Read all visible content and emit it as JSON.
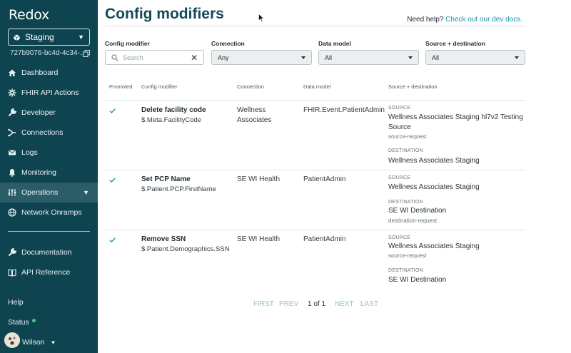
{
  "sidebar": {
    "logo": "Redox",
    "environment": "Staging",
    "environment_id": "727b9076-bc4d-4c34-...",
    "nav": [
      {
        "label": "Dashboard",
        "icon": "home-icon"
      },
      {
        "label": "FHIR API Actions",
        "icon": "fhir-icon"
      },
      {
        "label": "Developer",
        "icon": "wrench-icon"
      },
      {
        "label": "Connections",
        "icon": "connections-icon"
      },
      {
        "label": "Logs",
        "icon": "mail-icon"
      },
      {
        "label": "Monitoring",
        "icon": "bell-icon"
      },
      {
        "label": "Operations",
        "icon": "sliders-icon",
        "active": true
      },
      {
        "label": "Network Onramps",
        "icon": "globe-icon"
      }
    ],
    "secondary": [
      {
        "label": "Documentation",
        "icon": "wrench-icon"
      },
      {
        "label": "API Reference",
        "icon": "book-icon"
      }
    ],
    "help": "Help",
    "status": "Status",
    "user": "Wilson"
  },
  "page": {
    "title": "Config modifiers",
    "help_text": "Need help?",
    "help_link": "Check out our dev docs."
  },
  "filters": {
    "config_modifier": {
      "label": "Config modifier",
      "placeholder": "Search"
    },
    "connection": {
      "label": "Connection",
      "value": "Any"
    },
    "data_model": {
      "label": "Data model",
      "value": "All"
    },
    "source_destination": {
      "label": "Source + destination",
      "value": "All"
    }
  },
  "table": {
    "headers": [
      "Promoted",
      "Config modifier",
      "Connection",
      "Data model",
      "Source + destination"
    ],
    "source_label": "SOURCE",
    "destination_label": "DESTINATION",
    "rows": [
      {
        "promoted": true,
        "name": "Delete facility code",
        "path": "$.Meta.FacilityCode",
        "connection": "Wellness Associates",
        "data_model": "FHIR.Event.PatientAdmin",
        "source": "Wellness Associates Staging hl7v2 Testing Source",
        "source_sub": "source-request",
        "destination": "Wellness Associates Staging",
        "destination_sub": ""
      },
      {
        "promoted": true,
        "name": "Set PCP Name",
        "path": "$.Patient.PCP.FirstName",
        "connection": "SE WI Health",
        "data_model": "PatientAdmin",
        "source": "Wellness Associates Staging",
        "source_sub": "",
        "destination": "SE WI Destination",
        "destination_sub": "destination-request"
      },
      {
        "promoted": true,
        "name": "Remove SSN",
        "path": "$.Patient.Demographics.SSN",
        "connection": "SE WI Health",
        "data_model": "PatientAdmin",
        "source": "Wellness Associates Staging",
        "source_sub": "source-request",
        "destination": "SE WI Destination",
        "destination_sub": ""
      }
    ]
  },
  "pagination": {
    "first": "FIRST",
    "prev": "PREV",
    "current": "1 of 1",
    "next": "NEXT",
    "last": "LAST"
  },
  "colors": {
    "sidebar_bg": "#0e4450",
    "active_nav": "#2b5d68",
    "title": "#14495a",
    "link": "#1f8fa3",
    "check": "#2aa198",
    "status_dot": "#4cc58a"
  }
}
